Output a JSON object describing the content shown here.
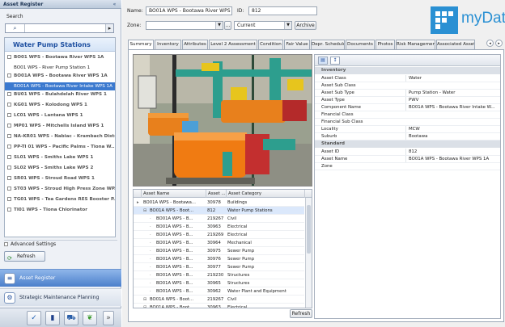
{
  "left_panel": {
    "title": "Asset Register",
    "collapse_glyph": "«",
    "search_label": "Search",
    "search_icon": "search-icon",
    "search_icon_glyph": "⌕",
    "search_go_glyph": "▸",
    "tree_title": "Water Pump Stations",
    "tree_items": [
      {
        "label": "BO01 WPS - Bootawa River WPS 1A",
        "child": false,
        "selected": false
      },
      {
        "label": "BO01 WPS - River Pump Station 1",
        "child": true,
        "selected": false
      },
      {
        "label": "BO01A WPS - Bootawa River WPS 1A",
        "child": false,
        "selected": false
      },
      {
        "label": "BO01A WPS - Bootawa River Intake WPS 1A",
        "child": true,
        "selected": true
      },
      {
        "label": "BU01 WPS - Bulahdelah River WPS 1",
        "child": false,
        "selected": false
      },
      {
        "label": "KG01 WPS - Kolodong WPS 1",
        "child": false,
        "selected": false
      },
      {
        "label": "LC01 WPS - Lantana WPS 1",
        "child": false,
        "selected": false
      },
      {
        "label": "MP01 WPS - Mitchells Island WPS 1",
        "child": false,
        "selected": false
      },
      {
        "label": "NA-KR01 WPS - Nabiac - Krambach Distri...",
        "child": false,
        "selected": false
      },
      {
        "label": "PP-TI 01 WPS - Pacific Palms - Tiona W...",
        "child": false,
        "selected": false
      },
      {
        "label": "SL01 WPS - Smiths Lake WPS 1",
        "child": false,
        "selected": false
      },
      {
        "label": "SL02 WPS - Smiths Lake WPS 2",
        "child": false,
        "selected": false
      },
      {
        "label": "SR01 WPS - Stroud Road WPS 1",
        "child": false,
        "selected": false
      },
      {
        "label": "ST03 WPS - Stroud High Press Zone WP...",
        "child": false,
        "selected": false
      },
      {
        "label": "TG01 WPS - Tea Gardens RES Booster P...",
        "child": false,
        "selected": false
      },
      {
        "label": "TI01 WPS - Tiona Chlorinator",
        "child": false,
        "selected": false
      }
    ],
    "advanced_settings": "Advanced Settings",
    "refresh": "Refresh",
    "nav": [
      {
        "label": "Asset Register",
        "active": true
      },
      {
        "label": "Strategic Maintenance Planning",
        "active": false
      }
    ]
  },
  "header": {
    "name_label": "Name:",
    "name_value": "BO01A WPS - Bootawa River WPS 1A",
    "id_label": "ID:",
    "id_value": "812",
    "zone_label": "Zone:",
    "zone_value": "",
    "status_value": "Current",
    "archive_label": "Archive"
  },
  "logo": {
    "text": "myData",
    "color": "#2a90d3"
  },
  "tabs": [
    "Summary",
    "Inventory",
    "Attributes",
    "Level 2 Assessment",
    "Condition",
    "Fair Value",
    "Depr. Schedule",
    "Documents",
    "Photos",
    "Risk Management",
    "Associated Asset"
  ],
  "active_tab": "Summary",
  "grid": {
    "columns": [
      "Asset Name",
      "Asset ...",
      "Asset Category"
    ],
    "rows": [
      {
        "name": "BO01A WPS - Bootawa...",
        "id": "30978",
        "category": "Buildings",
        "level": 0,
        "selected": false
      },
      {
        "name": "BO01A WPS - Boot...",
        "id": "812",
        "category": "Water Pump Stations",
        "level": 1,
        "selected": true
      },
      {
        "name": "BO01A WPS - B...",
        "id": "219267",
        "category": "Civil",
        "level": 2,
        "selected": false
      },
      {
        "name": "BO01A WPS - B...",
        "id": "30963",
        "category": "Electrical",
        "level": 2,
        "selected": false
      },
      {
        "name": "BO01A WPS - B...",
        "id": "219269",
        "category": "Electrical",
        "level": 2,
        "selected": false
      },
      {
        "name": "BO01A WPS - B...",
        "id": "30964",
        "category": "Mechanical",
        "level": 2,
        "selected": false
      },
      {
        "name": "BO01A WPS - B...",
        "id": "30975",
        "category": "Sewer Pump",
        "level": 2,
        "selected": false
      },
      {
        "name": "BO01A WPS - B...",
        "id": "30976",
        "category": "Sewer Pump",
        "level": 2,
        "selected": false
      },
      {
        "name": "BO01A WPS - B...",
        "id": "30977",
        "category": "Sewer Pump",
        "level": 2,
        "selected": false
      },
      {
        "name": "BO01A WPS - B...",
        "id": "219230",
        "category": "Structures",
        "level": 2,
        "selected": false
      },
      {
        "name": "BO01A WPS - B...",
        "id": "30965",
        "category": "Structures",
        "level": 2,
        "selected": false
      },
      {
        "name": "BO01A WPS - B...",
        "id": "30962",
        "category": "Water Plant and Equipment",
        "level": 2,
        "selected": false
      },
      {
        "name": "BO01A WPS - Boot...",
        "id": "219267",
        "category": "Civil",
        "level": 1,
        "selected": false
      },
      {
        "name": "BO01A WPS - Boot...",
        "id": "30963",
        "category": "Electrical",
        "level": 1,
        "selected": false
      }
    ],
    "refresh": "Refresh"
  },
  "properties": {
    "sections": [
      {
        "title": "Inventory",
        "rows": [
          {
            "key": "Asset Class",
            "value": "Water"
          },
          {
            "key": "Asset Sub Class",
            "value": ""
          },
          {
            "key": "Asset Sub Type",
            "value": "Pump Station - Water"
          },
          {
            "key": "Asset Type",
            "value": "PWV"
          },
          {
            "key": "Component Name",
            "value": "BO01A WPS - Bootawa River Intake W..."
          },
          {
            "key": "Financial Class",
            "value": ""
          },
          {
            "key": "Financial Sub Class",
            "value": ""
          },
          {
            "key": "Locality",
            "value": "MCW"
          },
          {
            "key": "Suburb",
            "value": "Bootawa"
          }
        ]
      },
      {
        "title": "Standard",
        "rows": [
          {
            "key": "Asset ID",
            "value": "812"
          },
          {
            "key": "Asset Name",
            "value": "BO01A WPS - Bootawa River WPS 1A"
          },
          {
            "key": "Zone",
            "value": ""
          }
        ]
      }
    ]
  }
}
